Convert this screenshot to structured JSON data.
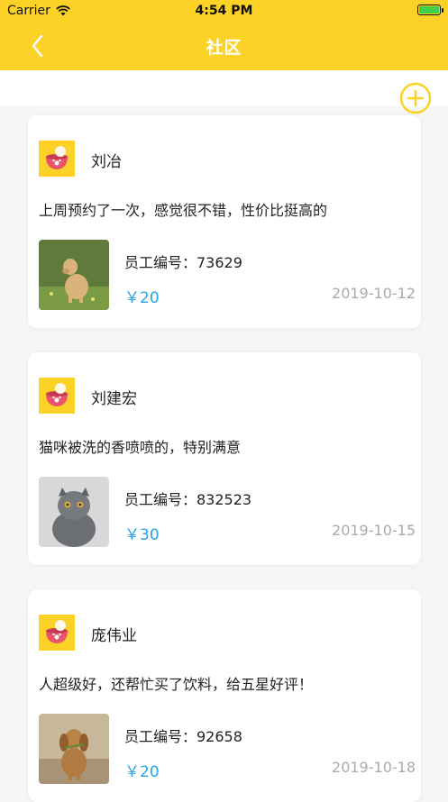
{
  "status": {
    "carrier": "Carrier",
    "time": "4:54 PM",
    "battery_level": 1.0
  },
  "navbar": {
    "title": "社区",
    "back_icon": "chevron-left-icon"
  },
  "toolbar": {
    "add_icon": "plus-circle-icon"
  },
  "colors": {
    "brand_yellow": "#fdd227",
    "price_blue": "#27a4e6",
    "date_gray": "#aaaaaa"
  },
  "posts": [
    {
      "name": "刘冶",
      "comment": "上周预约了一次，感觉很不错，性价比挺高的",
      "employee": "员工编号：73629",
      "price": "￥20",
      "date": "2019-10-12",
      "pet": "dog-photo"
    },
    {
      "name": "刘建宏",
      "comment": "猫咪被洗的香喷喷的，特别满意",
      "employee": "员工编号：832523",
      "price": "￥30",
      "date": "2019-10-15",
      "pet": "cat-photo"
    },
    {
      "name": "庞伟业",
      "comment": "人超级好，还帮忙买了饮料，给五星好评！",
      "employee": "员工编号：92658",
      "price": "￥20",
      "date": "2019-10-18",
      "pet": "dog-photo"
    }
  ]
}
